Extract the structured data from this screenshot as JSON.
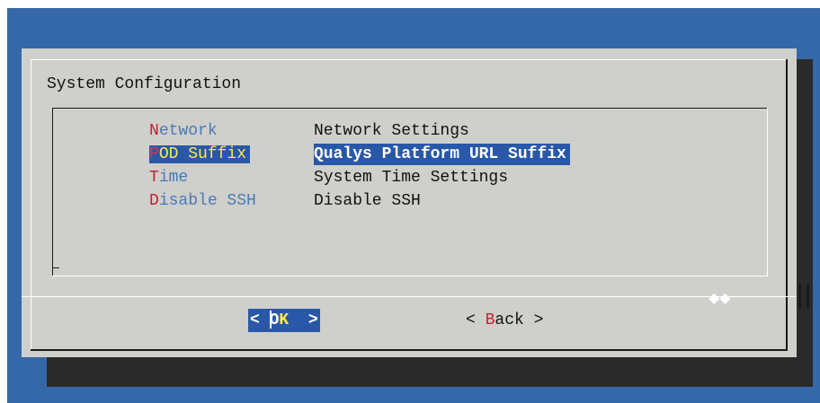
{
  "dialog": {
    "title": "System Configuration"
  },
  "menu": {
    "items": [
      {
        "tag_first": "N",
        "tag_rest": "etwork",
        "description": "Network Settings",
        "selected": false
      },
      {
        "tag_first": "P",
        "tag_rest": "OD Suffix",
        "description": "Qualys Platform URL Suffix",
        "selected": true
      },
      {
        "tag_first": "T",
        "tag_rest": "ime",
        "description": "System Time Settings",
        "selected": false
      },
      {
        "tag_first": "D",
        "tag_rest": "isable SSH",
        "description": "Disable SSH",
        "selected": false
      }
    ]
  },
  "buttons": {
    "ok": {
      "left_bracket": "< ",
      "hot": "O",
      "hot2": "K",
      "right_bracket": "  >"
    },
    "back": {
      "left_bracket": "< ",
      "hot": "B",
      "rest": "ack",
      "right_bracket": " >"
    }
  },
  "scroll_indicator": "◆◆",
  "colors": {
    "background": "#3468a8",
    "dialog": "#cfcfcb",
    "highlight": "#2a58a8",
    "hotkey": "#c8202a",
    "selected_hotkey": "#ffe94a"
  }
}
